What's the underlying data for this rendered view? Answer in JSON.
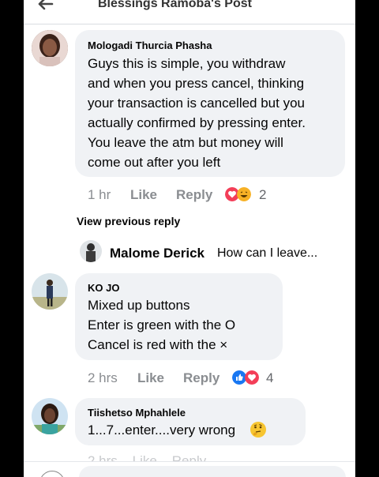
{
  "header": {
    "title": "Blessings Ramoba's Post"
  },
  "comments": [
    {
      "author": "Mologadi Thurcia Phasha",
      "lines": [
        "Guys this is simple,  you withdraw",
        "and when you press cancel, thinking",
        "your transaction is cancelled but you",
        "actually confirmed by pressing enter.",
        "You leave the atm but money will",
        "come out after you left"
      ],
      "time": "1 hr",
      "like": "Like",
      "reply": "Reply",
      "reaction_count": "2",
      "reactions": [
        "love-icon",
        "haha-icon"
      ]
    },
    {
      "author": "KO JO",
      "lines": [
        "Mixed up buttons",
        "Enter is green with the O",
        "Cancel is red with the ×"
      ],
      "time": "2 hrs",
      "like": "Like",
      "reply": "Reply",
      "reaction_count": "4",
      "reactions": [
        "like-icon",
        "love-icon"
      ]
    },
    {
      "author": "Tiishetso Mphahlele",
      "lines": [
        "1...7...enter....very wrong"
      ],
      "emoji": "thinking-face-icon"
    }
  ],
  "view_previous_reply": "View previous reply",
  "reply_preview": {
    "author": "Malome Derick",
    "snippet": "How can I leave..."
  },
  "colors": {
    "bubble": "#f0f2f5",
    "meta_text": "#8a8d91",
    "like_blue": "#1877f2",
    "love_red": "#f33e58",
    "haha_yellow": "#f7b125"
  }
}
